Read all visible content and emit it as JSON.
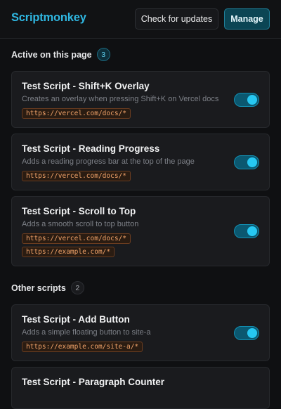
{
  "header": {
    "title": "Scriptmonkey",
    "updates_label": "Check for updates",
    "manage_label": "Manage"
  },
  "colors": {
    "accent": "#2fb6e0",
    "toggle_on": "#27c8f2",
    "chip_text": "#f3a46a"
  },
  "active_section": {
    "heading": "Active on this page",
    "count": "3",
    "scripts": [
      {
        "title": "Test Script - Shift+K Overlay",
        "description": "Creates an overlay when pressing Shift+K on Vercel docs",
        "matches": [
          "https://vercel.com/docs/*"
        ],
        "enabled": true
      },
      {
        "title": "Test Script - Reading Progress",
        "description": "Adds a reading progress bar at the top of the page",
        "matches": [
          "https://vercel.com/docs/*"
        ],
        "enabled": true
      },
      {
        "title": "Test Script - Scroll to Top",
        "description": "Adds a smooth scroll to top button",
        "matches": [
          "https://vercel.com/docs/*",
          "https://example.com/*"
        ],
        "enabled": true
      }
    ]
  },
  "other_section": {
    "heading": "Other scripts",
    "count": "2",
    "scripts": [
      {
        "title": "Test Script - Add Button",
        "description": "Adds a simple floating button to site-a",
        "matches": [
          "https://example.com/site-a/*"
        ],
        "enabled": true
      },
      {
        "title": "Test Script - Paragraph Counter"
      }
    ]
  }
}
